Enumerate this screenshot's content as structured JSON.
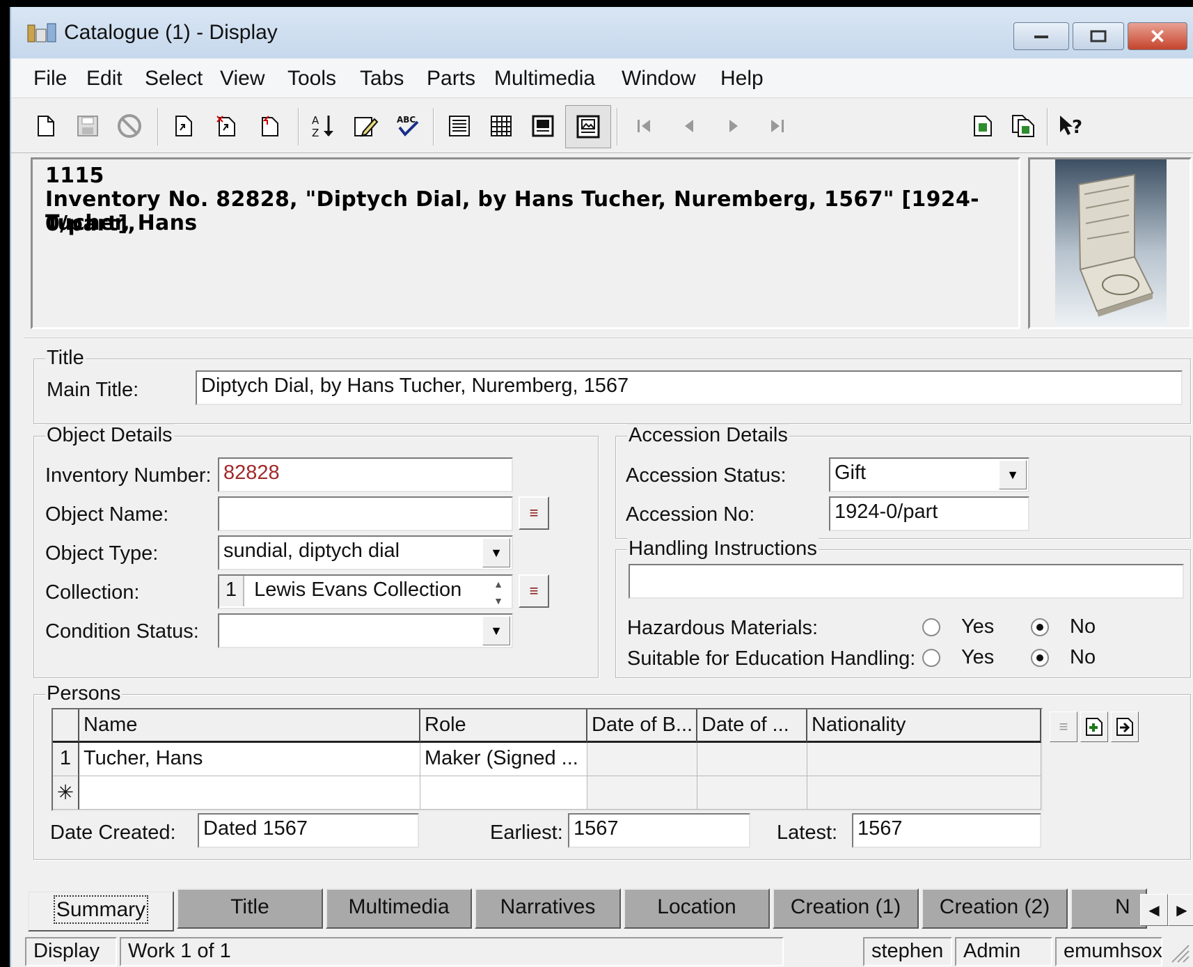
{
  "window": {
    "title": "Catalogue (1) - Display"
  },
  "menu": [
    "File",
    "Edit",
    "Select",
    "View",
    "Tools",
    "Tabs",
    "Parts",
    "Multimedia",
    "Window",
    "Help"
  ],
  "toolbar_icons": [
    "new-record-icon",
    "save-icon",
    "cancel-icon",
    "select-icon",
    "select-all-icon",
    "deselect-icon",
    "sort-icon",
    "edit-icon",
    "spellcheck-icon",
    "list-view-icon",
    "grid-view-icon",
    "page-view-icon",
    "image-view-icon",
    "first-record-icon",
    "previous-record-icon",
    "next-record-icon",
    "last-record-icon",
    "copy-record-icon",
    "copy-records-icon",
    "help-icon"
  ],
  "header": {
    "line1": "1115",
    "line2": "Inventory No. 82828, \"Diptych Dial, by Hans Tucher, Nuremberg, 1567\" [1924-0/part],",
    "line3": "Tucher, Hans"
  },
  "title_group": {
    "legend": "Title",
    "main_title_label": "Main Title:",
    "main_title_value": "Diptych Dial, by Hans Tucher, Nuremberg, 1567"
  },
  "object_details": {
    "legend": "Object Details",
    "inventory_label": "Inventory Number:",
    "inventory_value": "82828",
    "object_name_label": "Object Name:",
    "object_name_value": "",
    "object_type_label": "Object Type:",
    "object_type_value": "sundial, diptych dial",
    "collection_label": "Collection:",
    "collection_index": "1",
    "collection_value": "Lewis Evans Collection",
    "condition_label": "Condition Status:",
    "condition_value": ""
  },
  "accession": {
    "legend": "Accession Details",
    "status_label": "Accession Status:",
    "status_value": "Gift",
    "no_label": "Accession No:",
    "no_value": "1924-0/part"
  },
  "handling": {
    "legend": "Handling Instructions",
    "value": "",
    "hazard_label": "Hazardous Materials:",
    "education_label": "Suitable for Education Handling:",
    "yes_label": "Yes",
    "no_label": "No",
    "hazard_selected": "No",
    "education_selected": "No"
  },
  "persons": {
    "legend": "Persons",
    "columns": [
      "Name",
      "Role",
      "Date of B...",
      "Date of ...",
      "Nationality"
    ],
    "rows": [
      {
        "num": "1",
        "name": "Tucher, Hans",
        "role": "Maker (Signed ...",
        "dob": "",
        "dod": "",
        "nationality": ""
      }
    ],
    "new_row_marker": "✳",
    "date_created_label": "Date Created:",
    "date_created_value": "Dated 1567",
    "earliest_label": "Earliest:",
    "earliest_value": "1567",
    "latest_label": "Latest:",
    "latest_value": "1567"
  },
  "tabs": [
    "Summary",
    "Title",
    "Multimedia",
    "Narratives",
    "Location",
    "Creation (1)",
    "Creation (2)",
    "N"
  ],
  "active_tab": "Summary",
  "status": {
    "mode": "Display",
    "record": "Work 1 of 1",
    "user": "stephen",
    "group": "Admin",
    "host": "emumhsox"
  }
}
